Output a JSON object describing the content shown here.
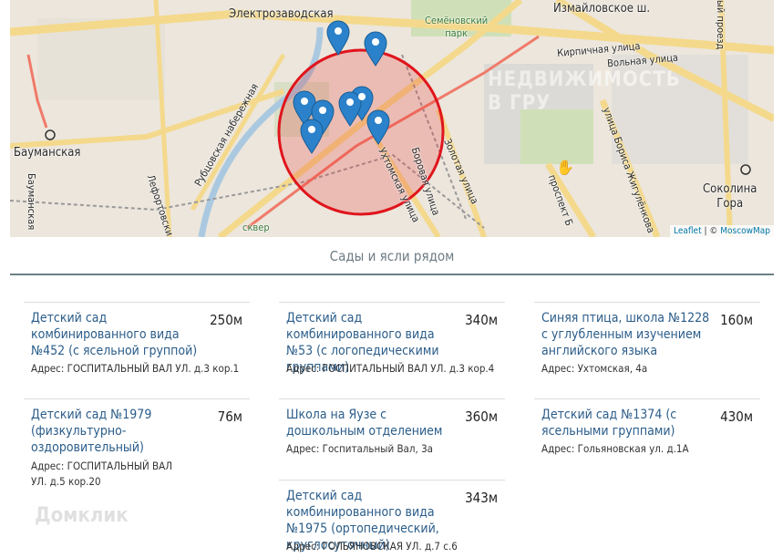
{
  "map": {
    "labels": {
      "elektrozavodskaya": "Электрозаводская",
      "semenovsky_park": "Семёновский\nпарк",
      "izmaylovskoe": "Измайловское ш.",
      "kirpichnaya": "Кирпичная улица",
      "volnaya": "Вольная улица",
      "baumanskaya": "Бауманская",
      "baumanskaya_st": "Бауманская",
      "rubtsovskaya": "Рубцовская набережная",
      "lefortovskiy": "Лефортовски",
      "ukhtomskaya": "Ухтомская улица",
      "borovaya": "Боровая улица",
      "zolotaya": "Золотая улица",
      "prospekt": "проспект Б",
      "borisa_zhig": "улица Бориса Жигулёнкова",
      "sokolina_gora": "Соколина\nГора",
      "skver": "сквер",
      "proezd": "ый проезд"
    },
    "watermark": "НЕДВИЖИМОСТЬ\nВ ГРУ",
    "attribution_leaflet": "Leaflet",
    "attribution_sep": " | © ",
    "attribution_moscowmap": "MoscowMap"
  },
  "section_title": "Сады и ясли рядом",
  "cards": [
    {
      "name": "Детский сад комбинированного вида №452 (с ясельной группой)",
      "distance": "250м",
      "address": "Адрес: ГОСПИТАЛЬНЫЙ ВАЛ УЛ. д.3 кор.1"
    },
    {
      "name": "Детский сад комбинированного вида №53 (с логопедическими группами)",
      "distance": "340м",
      "address": "Адрес: ГОСПИТАЛЬНЫЙ ВАЛ УЛ. д.3 кор.4"
    },
    {
      "name": "Синяя птица, школа №1228 с углубленным изучением английского языка",
      "distance": "160м",
      "address": "Адрес: Ухтомская, 4а"
    },
    {
      "name": "Детский сад №1979 (физкультурно-оздоровительный)",
      "distance": "76м",
      "address": "Адрес: ГОСПИТАЛЬНЫЙ ВАЛ УЛ. д.5 кор.20"
    },
    {
      "name": "Школа на Яузе с дошкольным отделением",
      "distance": "360м",
      "address": "Адрес: Госпитальный Вал, 3а"
    },
    {
      "name": "Детский сад №1374 (с ясельными группами)",
      "distance": "430м",
      "address": "Адрес: Гольяновская ул. д.1А"
    },
    {
      "name": "Детский сад комбинированного вида №1975 (ортопедический, круглосуточный)",
      "distance": "343м",
      "address": "Адрес: ГОЛЬЯНОВСКАЯ УЛ. д.7 с.6"
    }
  ],
  "watermark_brand": "Домклик",
  "colors": {
    "link": "#2b5d8a",
    "divider": "#6d7f86",
    "circle": "#e0141c",
    "marker": "#2b82cb"
  }
}
